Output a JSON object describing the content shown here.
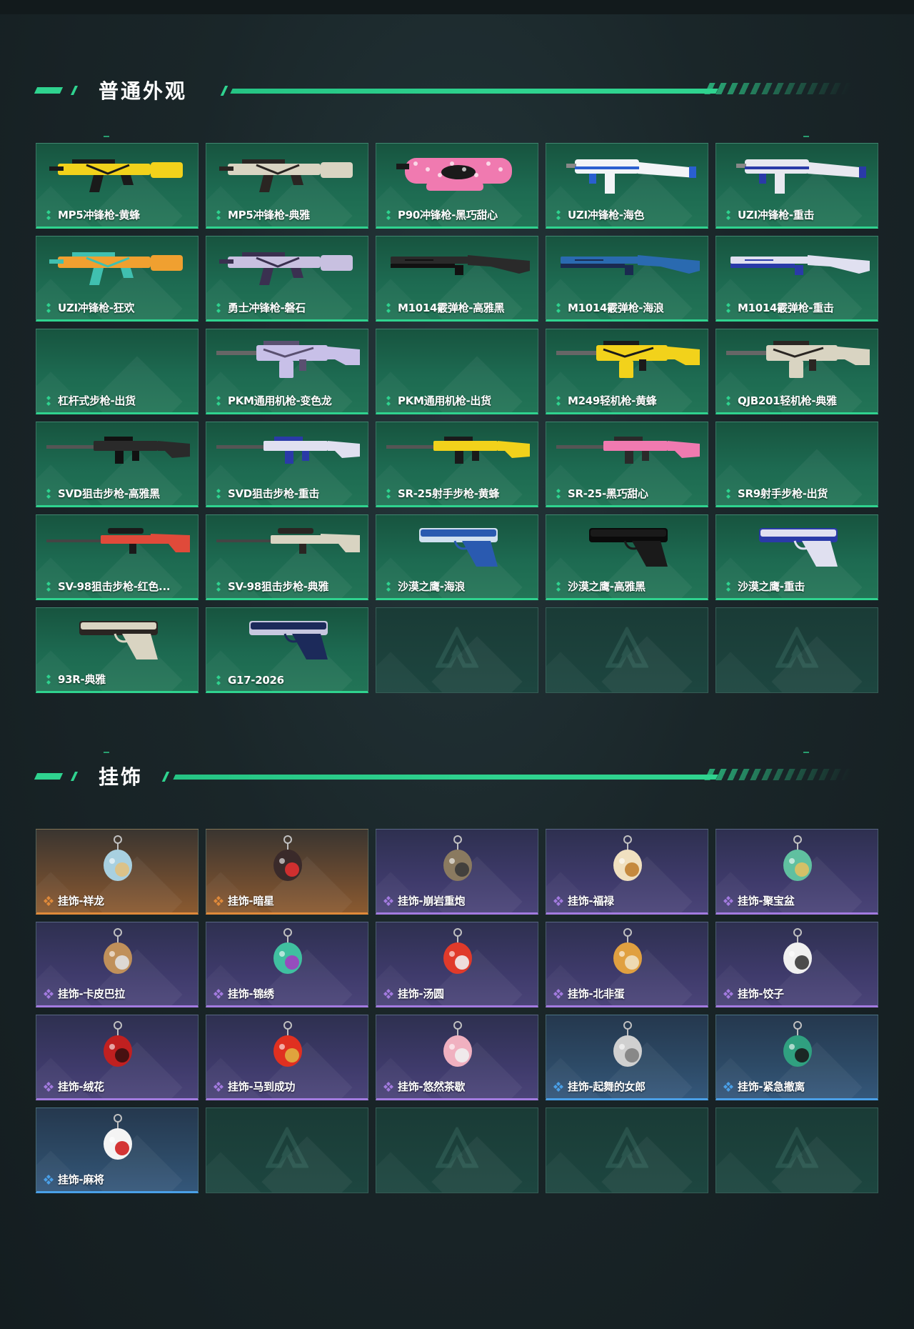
{
  "sections": [
    {
      "title": "普通外观",
      "items": [
        {
          "label": "MP5冲锋枪-黄蜂",
          "rarity": "weapon",
          "art": "smg",
          "colors": [
            "#f2d21b",
            "#1a1a1a"
          ]
        },
        {
          "label": "MP5冲锋枪-典雅",
          "rarity": "weapon",
          "art": "smg",
          "colors": [
            "#d9d4c2",
            "#2a2522"
          ]
        },
        {
          "label": "P90冲锋枪-黑巧甜心",
          "rarity": "weapon",
          "art": "p90",
          "colors": [
            "#f07ab0",
            "#1a1a1a"
          ]
        },
        {
          "label": "UZI冲锋枪-海色",
          "rarity": "weapon",
          "art": "uzi",
          "colors": [
            "#f2f4f7",
            "#2a5fd0"
          ]
        },
        {
          "label": "UZI冲锋枪-重击",
          "rarity": "weapon",
          "art": "uzi",
          "colors": [
            "#e8e8f0",
            "#2a3aa8"
          ]
        },
        {
          "label": "UZI冲锋枪-狂欢",
          "rarity": "weapon",
          "art": "smg",
          "colors": [
            "#f0a030",
            "#40c0b0"
          ]
        },
        {
          "label": "勇士冲锋枪-磐石",
          "rarity": "weapon",
          "art": "smg",
          "colors": [
            "#c8c0e0",
            "#3a3050"
          ]
        },
        {
          "label": "M1014霰弹枪-高雅黑",
          "rarity": "weapon",
          "art": "shotgun",
          "colors": [
            "#2a2a2a",
            "#111111"
          ]
        },
        {
          "label": "M1014霰弹枪-海浪",
          "rarity": "weapon",
          "art": "shotgun",
          "colors": [
            "#2a6ab0",
            "#1a2a50"
          ]
        },
        {
          "label": "M1014霰弹枪-重击",
          "rarity": "weapon",
          "art": "shotgun",
          "colors": [
            "#e0e0f0",
            "#2a3aa8"
          ]
        },
        {
          "label": "杠杆式步枪-出货",
          "rarity": "weapon",
          "art": "none",
          "colors": [
            "#000000",
            "#000000"
          ]
        },
        {
          "label": "PKM通用机枪-变色龙",
          "rarity": "weapon",
          "art": "mg",
          "colors": [
            "#c8c0e8",
            "#5a5070"
          ]
        },
        {
          "label": "PKM通用机枪-出货",
          "rarity": "weapon",
          "art": "none",
          "colors": [
            "#000000",
            "#000000"
          ]
        },
        {
          "label": "M249轻机枪-黄蜂",
          "rarity": "weapon",
          "art": "mg",
          "colors": [
            "#f2d21b",
            "#1a1a1a"
          ]
        },
        {
          "label": "QJB201轻机枪-典雅",
          "rarity": "weapon",
          "art": "mg",
          "colors": [
            "#d9d4c2",
            "#2a2522"
          ]
        },
        {
          "label": "SVD狙击步枪-高雅黑",
          "rarity": "weapon",
          "art": "rifle",
          "colors": [
            "#2a2a2a",
            "#111111"
          ]
        },
        {
          "label": "SVD狙击步枪-重击",
          "rarity": "weapon",
          "art": "rifle",
          "colors": [
            "#e0e0f0",
            "#2a3aa8"
          ]
        },
        {
          "label": "SR-25射手步枪-黄蜂",
          "rarity": "weapon",
          "art": "rifle",
          "colors": [
            "#f2d21b",
            "#1a1a1a"
          ]
        },
        {
          "label": "SR-25-黑巧甜心",
          "rarity": "weapon",
          "art": "rifle",
          "colors": [
            "#f07ab0",
            "#2a2a2a"
          ]
        },
        {
          "label": "SR9射手步枪-出货",
          "rarity": "weapon",
          "art": "none",
          "colors": [
            "#000000",
            "#000000"
          ]
        },
        {
          "label": "SV-98狙击步枪-红色...",
          "rarity": "weapon",
          "art": "sniper",
          "colors": [
            "#e04a3a",
            "#1a1a1a"
          ]
        },
        {
          "label": "SV-98狙击步枪-典雅",
          "rarity": "weapon",
          "art": "sniper",
          "colors": [
            "#d9d4c2",
            "#2a2522"
          ]
        },
        {
          "label": "沙漠之鹰-海浪",
          "rarity": "weapon",
          "art": "pistol",
          "colors": [
            "#2a5ab0",
            "#d0e0f0"
          ]
        },
        {
          "label": "沙漠之鹰-高雅黑",
          "rarity": "weapon",
          "art": "pistol",
          "colors": [
            "#1a1a1a",
            "#0a0a0a"
          ]
        },
        {
          "label": "沙漠之鹰-重击",
          "rarity": "weapon",
          "art": "pistol",
          "colors": [
            "#e0e0f0",
            "#2a3aa8"
          ]
        },
        {
          "label": "93R-典雅",
          "rarity": "weapon",
          "art": "pistol",
          "colors": [
            "#d9d4c2",
            "#2a2522"
          ]
        },
        {
          "label": "G17-2026",
          "rarity": "weapon",
          "art": "pistol",
          "colors": [
            "#1c2a5a",
            "#c8c8e0"
          ]
        },
        {
          "label": "",
          "rarity": "empty",
          "art": "none",
          "colors": [
            "#000000",
            "#000000"
          ]
        },
        {
          "label": "",
          "rarity": "empty",
          "art": "none",
          "colors": [
            "#000000",
            "#000000"
          ]
        },
        {
          "label": "",
          "rarity": "empty",
          "art": "none",
          "colors": [
            "#000000",
            "#000000"
          ]
        }
      ]
    },
    {
      "title": "挂饰",
      "items": [
        {
          "label": "挂饰-祥龙",
          "rarity": "gold",
          "art": "charm",
          "colors": [
            "#a8d0e0",
            "#e0c080"
          ]
        },
        {
          "label": "挂饰-暗星",
          "rarity": "gold",
          "art": "charm",
          "colors": [
            "#3a2a2a",
            "#e03030"
          ]
        },
        {
          "label": "挂饰-崩岩重炮",
          "rarity": "purple",
          "art": "charm",
          "colors": [
            "#8a7a60",
            "#3a3a3a"
          ]
        },
        {
          "label": "挂饰-福禄",
          "rarity": "purple",
          "art": "charm",
          "colors": [
            "#f0e0c0",
            "#c08030"
          ]
        },
        {
          "label": "挂饰-聚宝盆",
          "rarity": "purple",
          "art": "charm",
          "colors": [
            "#60c0a0",
            "#e0c060"
          ]
        },
        {
          "label": "挂饰-卡皮巴拉",
          "rarity": "purple",
          "art": "charm",
          "colors": [
            "#c0905a",
            "#e0e0e0"
          ]
        },
        {
          "label": "挂饰-锦绣",
          "rarity": "purple",
          "art": "charm",
          "colors": [
            "#40c0a0",
            "#a040c0"
          ]
        },
        {
          "label": "挂饰-汤圆",
          "rarity": "purple",
          "art": "charm",
          "colors": [
            "#e03a2a",
            "#f0f0f0"
          ]
        },
        {
          "label": "挂饰-北非蛋",
          "rarity": "purple",
          "art": "charm",
          "colors": [
            "#e0a040",
            "#f0e0c0"
          ]
        },
        {
          "label": "挂饰-饺子",
          "rarity": "purple",
          "art": "charm",
          "colors": [
            "#f0f0f0",
            "#3a3a3a"
          ]
        },
        {
          "label": "挂饰-绒花",
          "rarity": "purple",
          "art": "charm",
          "colors": [
            "#c02020",
            "#3a1010"
          ]
        },
        {
          "label": "挂饰-马到成功",
          "rarity": "purple",
          "art": "charm",
          "colors": [
            "#e03020",
            "#e0b040"
          ]
        },
        {
          "label": "挂饰-悠然茶歇",
          "rarity": "purple",
          "art": "charm",
          "colors": [
            "#f0b0c0",
            "#f0f0f0"
          ]
        },
        {
          "label": "挂饰-起舞的女郎",
          "rarity": "blue",
          "art": "charm",
          "colors": [
            "#d0d0d0",
            "#808080"
          ]
        },
        {
          "label": "挂饰-紧急撤离",
          "rarity": "blue",
          "art": "charm",
          "colors": [
            "#30a080",
            "#1a1a1a"
          ]
        },
        {
          "label": "挂饰-麻将",
          "rarity": "blue",
          "art": "charm",
          "colors": [
            "#f4f4f4",
            "#d02020"
          ]
        },
        {
          "label": "",
          "rarity": "empty",
          "art": "none",
          "colors": [
            "#000000",
            "#000000"
          ]
        },
        {
          "label": "",
          "rarity": "empty",
          "art": "none",
          "colors": [
            "#000000",
            "#000000"
          ]
        },
        {
          "label": "",
          "rarity": "empty",
          "art": "none",
          "colors": [
            "#000000",
            "#000000"
          ]
        },
        {
          "label": "",
          "rarity": "empty",
          "art": "none",
          "colors": [
            "#000000",
            "#000000"
          ]
        }
      ]
    }
  ]
}
